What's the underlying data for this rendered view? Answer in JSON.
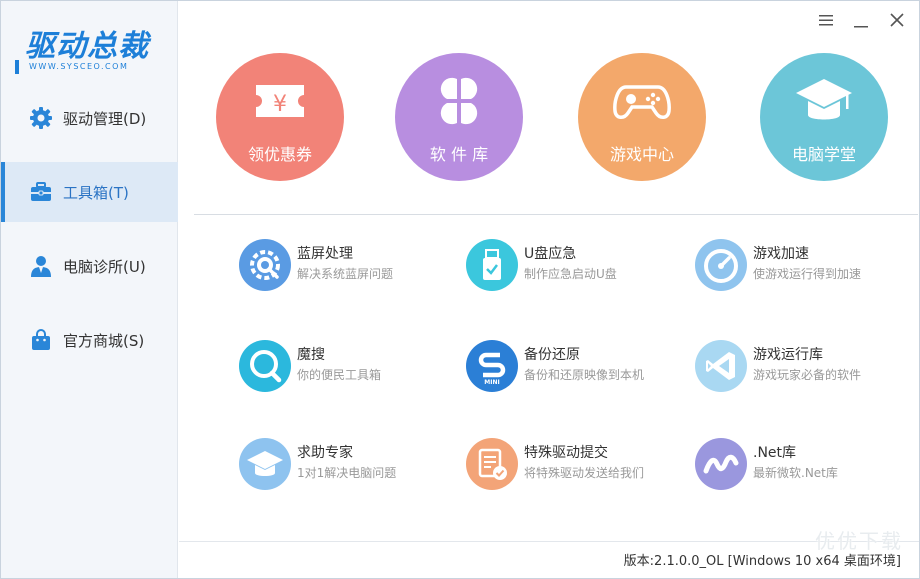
{
  "app": {
    "logo_text": "驱动总裁",
    "logo_sub": "WWW.SYSCEO.COM"
  },
  "sidebar": {
    "items": [
      {
        "label": "驱动管理(D)",
        "icon": "gear-icon"
      },
      {
        "label": "工具箱(T)",
        "icon": "toolbox-icon",
        "active": true
      },
      {
        "label": "电脑诊所(U)",
        "icon": "doctor-icon"
      },
      {
        "label": "官方商城(S)",
        "icon": "shopping-bag-icon"
      }
    ]
  },
  "window_controls": {
    "menu": "menu-icon",
    "minimize": "minimize-icon",
    "close": "close-icon"
  },
  "circles": [
    {
      "label": "领优惠券",
      "color": "#f28378",
      "icon": "coupon-icon"
    },
    {
      "label": "软 件 库",
      "color": "#b88ee0",
      "icon": "clover-grid-icon"
    },
    {
      "label": "游戏中心",
      "color": "#f3a86b",
      "icon": "gamepad-icon"
    },
    {
      "label": "电脑学堂",
      "color": "#6cc6d8",
      "icon": "graduation-cap-icon"
    }
  ],
  "tools": [
    {
      "title": "蓝屏处理",
      "desc": "解决系统蓝屏问题",
      "color": "#5a9be3",
      "icon": "gear-wrench-icon"
    },
    {
      "title": "U盘应急",
      "desc": "制作应急启动U盘",
      "color": "#3bc7dd",
      "icon": "usb-drive-icon"
    },
    {
      "title": "游戏加速",
      "desc": "使游戏运行得到加速",
      "color": "#8fc4ee",
      "icon": "speedometer-icon"
    },
    {
      "title": "魔搜",
      "desc": "你的便民工具箱",
      "color": "#2bb8dd",
      "icon": "magnifier-icon"
    },
    {
      "title": "备份还原",
      "desc": "备份和还原映像到本机",
      "color": "#2b7fd6",
      "icon": "backup-mini-icon"
    },
    {
      "title": "游戏运行库",
      "desc": "游戏玩家必备的软件",
      "color": "#a9d8f2",
      "icon": "visual-studio-icon"
    },
    {
      "title": "求助专家",
      "desc": "1对1解决电脑问题",
      "color": "#8ec3ef",
      "icon": "expert-cap-icon"
    },
    {
      "title": "特殊驱动提交",
      "desc": "将特殊驱动发送给我们",
      "color": "#f3a478",
      "icon": "document-check-icon"
    },
    {
      "title": ".Net库",
      "desc": "最新微软.Net库",
      "color": "#9a97de",
      "icon": "dotnet-icon"
    }
  ],
  "footer": {
    "version": "版本:2.1.0.0_OL [Windows 10 x64 桌面环境]"
  },
  "watermark": {
    "text": "优优下载"
  }
}
